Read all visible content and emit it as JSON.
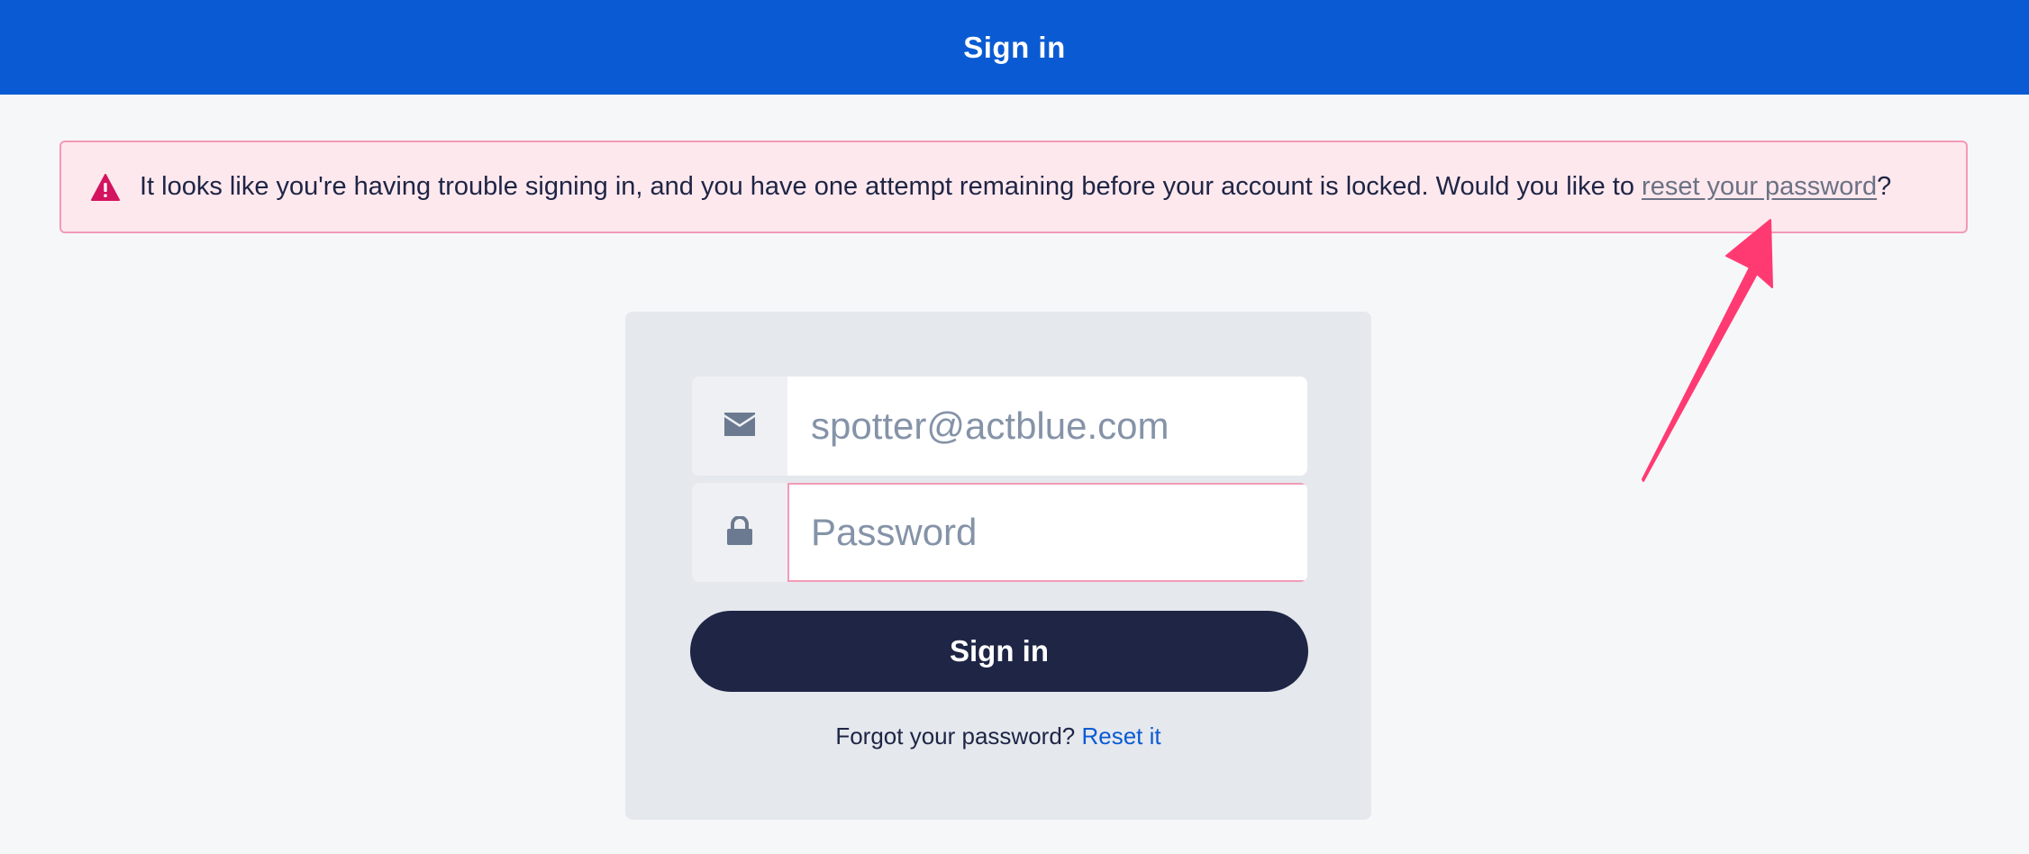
{
  "header": {
    "title": "Sign in"
  },
  "alert": {
    "icon": "warning-icon",
    "text_before": "It looks like you're having trouble signing in, and you have one attempt remaining before your account is locked. Would you like to ",
    "link_text": "reset your password",
    "text_after": "?"
  },
  "form": {
    "email": {
      "icon": "envelope-icon",
      "value": "",
      "placeholder": "spotter@actblue.com"
    },
    "password": {
      "icon": "lock-icon",
      "value": "",
      "placeholder": "Password"
    },
    "submit_label": "Sign in",
    "forgot_text": "Forgot your password?",
    "forgot_link": "Reset it"
  },
  "colors": {
    "header_bg": "#0a5bd3",
    "alert_bg": "#fde8ee",
    "alert_border": "#f39ab7",
    "button_bg": "#1e2545",
    "link": "#0a5bd3",
    "annotation_arrow": "#ff3a72"
  }
}
